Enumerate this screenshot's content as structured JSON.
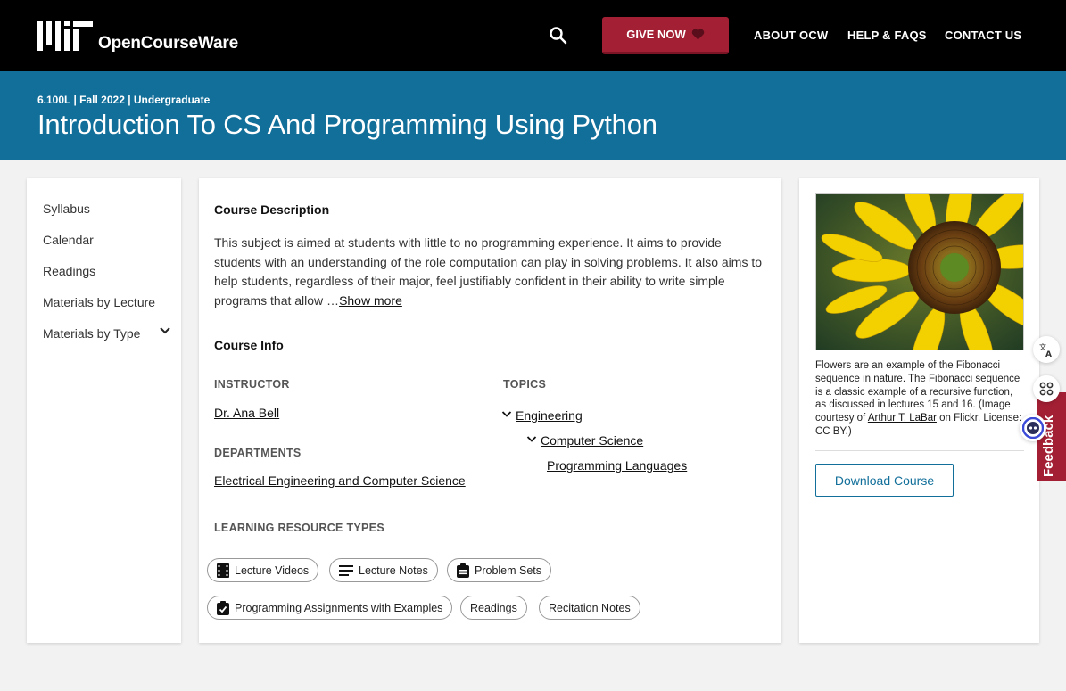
{
  "header": {
    "logo_text": "OpenCourseWare",
    "give_label": "GIVE NOW",
    "nav": [
      "ABOUT OCW",
      "HELP & FAQS",
      "CONTACT US"
    ],
    "brand_color": "#a31f34"
  },
  "banner": {
    "meta": "6.100L | Fall 2022 | Undergraduate",
    "title": "Introduction To CS And Programming Using Python",
    "bg_color": "#126f9a"
  },
  "sidebar": {
    "items": [
      "Syllabus",
      "Calendar",
      "Readings",
      "Materials by Lecture",
      "Materials by Type"
    ]
  },
  "main": {
    "desc_heading": "Course Description",
    "description": "This subject is aimed at students with little to no programming experience. It aims to provide students with an understanding of the role computation can play in solving problems. It also aims to help students, regardless of their major, feel justifiably confident in their ability to write simple programs that allow …",
    "show_more": "Show more",
    "info_heading": "Course Info",
    "instructor_label": "INSTRUCTOR",
    "instructor": "Dr. Ana Bell",
    "departments_label": "DEPARTMENTS",
    "department": "Electrical Engineering and Computer Science",
    "topics_label": "TOPICS",
    "topics": [
      "Engineering",
      "Computer Science",
      "Programming Languages"
    ],
    "lrt_label": "LEARNING RESOURCE TYPES",
    "resource_types": [
      "Lecture Videos",
      "Lecture Notes",
      "Problem Sets",
      "Programming Assignments with Examples",
      "Readings",
      "Recitation Notes"
    ]
  },
  "right": {
    "caption_pre": "Flowers are an example of the Fibonacci sequence in nature. The Fibonacci sequence is a classic example of a recursive function, as discussed in lectures 15 and 16. (Image courtesy of ",
    "caption_link": "Arthur T. LaBar",
    "caption_post": " on Flickr. License: CC BY.)",
    "download_label": "Download Course"
  },
  "widgets": {
    "feedback_label": "Feedback"
  }
}
